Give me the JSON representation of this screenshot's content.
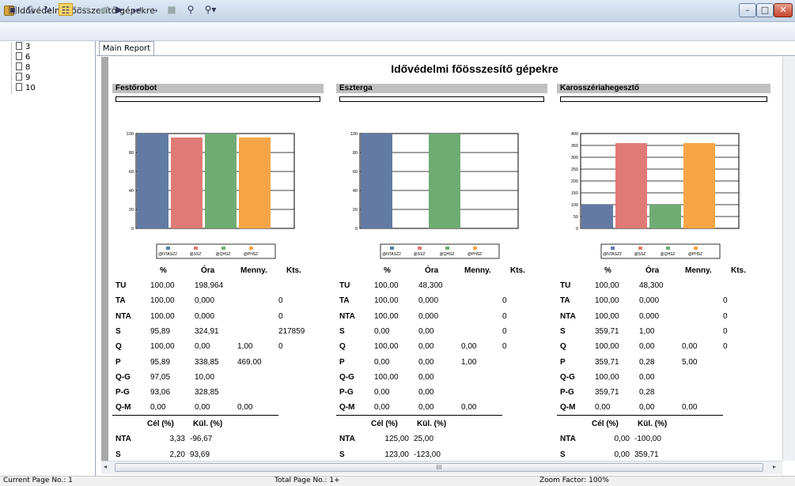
{
  "window": {
    "title": "Idővédelmi főösszesítő gépekre",
    "minimize": "–",
    "maximize": "□",
    "close": "✕"
  },
  "toolbar": {
    "icons": [
      "open-icon",
      "print-icon",
      "refresh-icon",
      "tree-toggle-icon",
      "first-page-icon",
      "prev-page-icon",
      "next-page-icon",
      "last-page-icon",
      "goto-icon",
      "stop-icon",
      "find-icon",
      "zoom-icon"
    ]
  },
  "tree": {
    "items": [
      "3",
      "6",
      "8",
      "9",
      "10"
    ]
  },
  "tabs": [
    {
      "label": "Main Report"
    }
  ],
  "report": {
    "title": "Idővédelmi főösszesítő gépekre",
    "headers": {
      "pct": "%",
      "ora": "Óra",
      "menny": "Menny.",
      "kts": "Kts.",
      "cel": "Cél (%)",
      "kul": "Kül. (%)"
    },
    "legend": [
      "@NTASZ2",
      "@SSZ",
      "@QHSZ",
      "@PHSZ"
    ],
    "colors": [
      "#627aa4",
      "#e07a76",
      "#6fac74",
      "#f6a546"
    ],
    "sections": [
      {
        "name": "Festőrobot",
        "chart_data": {
          "type": "bar",
          "categories": [
            "@NTASZ2",
            "@SSZ",
            "@QHSZ",
            "@PHSZ"
          ],
          "values": [
            100,
            95.89,
            100,
            95.89
          ],
          "ylim": [
            0,
            100
          ],
          "yticks": [
            "0",
            "20",
            "40",
            "60",
            "80",
            "100"
          ]
        },
        "rows": [
          {
            "label": "TU",
            "pct": "100,00",
            "ora": "198,964",
            "menny": "",
            "kts": ""
          },
          {
            "label": "TA",
            "pct": "100,00",
            "ora": "0,000",
            "menny": "",
            "kts": "0"
          },
          {
            "label": "NTA",
            "pct": "100,00",
            "ora": "0,000",
            "menny": "",
            "kts": "0"
          },
          {
            "label": "S",
            "pct": "95,89",
            "ora": "324,91",
            "menny": "",
            "kts": "217859"
          },
          {
            "label": "Q",
            "pct": "100,00",
            "ora": "0,00",
            "menny": "1,00",
            "kts": "0"
          },
          {
            "label": "P",
            "pct": "95,89",
            "ora": "338,85",
            "menny": "469,00",
            "kts": ""
          },
          {
            "label": "Q-G",
            "pct": "97,05",
            "ora": "10,00",
            "menny": "",
            "kts": ""
          },
          {
            "label": "P-G",
            "pct": "93,06",
            "ora": "328,85",
            "menny": "",
            "kts": ""
          },
          {
            "label": "Q-M",
            "pct": "0,00",
            "ora": "0,00",
            "menny": "0,00",
            "kts": ""
          }
        ],
        "goals": [
          {
            "label": "NTA",
            "cel": "3,33",
            "kul": "-96,67"
          },
          {
            "label": "S",
            "cel": "2,20",
            "kul": "93,69"
          }
        ]
      },
      {
        "name": "Eszterga",
        "chart_data": {
          "type": "bar",
          "categories": [
            "@NTASZ2",
            "@SSZ",
            "@QHSZ",
            "@PHSZ"
          ],
          "values": [
            100,
            0,
            100,
            0
          ],
          "ylim": [
            0,
            100
          ],
          "yticks": [
            "0",
            "20",
            "40",
            "60",
            "80",
            "100"
          ]
        },
        "rows": [
          {
            "label": "TU",
            "pct": "100,00",
            "ora": "48,300",
            "menny": "",
            "kts": ""
          },
          {
            "label": "TA",
            "pct": "100,00",
            "ora": "0,000",
            "menny": "",
            "kts": "0"
          },
          {
            "label": "NTA",
            "pct": "100,00",
            "ora": "0,000",
            "menny": "",
            "kts": "0"
          },
          {
            "label": "S",
            "pct": "0,00",
            "ora": "0,00",
            "menny": "",
            "kts": "0"
          },
          {
            "label": "Q",
            "pct": "100,00",
            "ora": "0,00",
            "menny": "0,00",
            "kts": "0"
          },
          {
            "label": "P",
            "pct": "0,00",
            "ora": "0,00",
            "menny": "1,00",
            "kts": ""
          },
          {
            "label": "Q-G",
            "pct": "100,00",
            "ora": "0,00",
            "menny": "",
            "kts": ""
          },
          {
            "label": "P-G",
            "pct": "0,00",
            "ora": "0,00",
            "menny": "",
            "kts": ""
          },
          {
            "label": "Q-M",
            "pct": "0,00",
            "ora": "0,00",
            "menny": "0,00",
            "kts": ""
          }
        ],
        "goals": [
          {
            "label": "NTA",
            "cel": "125,00",
            "kul": "25,00"
          },
          {
            "label": "S",
            "cel": "123,00",
            "kul": "-123,00"
          }
        ]
      },
      {
        "name": "Karosszériahegesztő",
        "chart_data": {
          "type": "bar",
          "categories": [
            "@NTASZ2",
            "@SSZ",
            "@QHSZ",
            "@PHSZ"
          ],
          "values": [
            100,
            359.71,
            100,
            359.71
          ],
          "ylim": [
            0,
            400
          ],
          "yticks": [
            "0",
            "50",
            "100",
            "150",
            "200",
            "250",
            "300",
            "350",
            "400"
          ]
        },
        "rows": [
          {
            "label": "TU",
            "pct": "100,00",
            "ora": "48,300",
            "menny": "",
            "kts": ""
          },
          {
            "label": "TA",
            "pct": "100,00",
            "ora": "0,000",
            "menny": "",
            "kts": "0"
          },
          {
            "label": "NTA",
            "pct": "100,00",
            "ora": "0,000",
            "menny": "",
            "kts": "0"
          },
          {
            "label": "S",
            "pct": "359,71",
            "ora": "1,00",
            "menny": "",
            "kts": "0"
          },
          {
            "label": "Q",
            "pct": "100,00",
            "ora": "0,00",
            "menny": "0,00",
            "kts": "0"
          },
          {
            "label": "P",
            "pct": "359,71",
            "ora": "0,28",
            "menny": "5,00",
            "kts": ""
          },
          {
            "label": "Q-G",
            "pct": "100,00",
            "ora": "0,00",
            "menny": "",
            "kts": ""
          },
          {
            "label": "P-G",
            "pct": "359,71",
            "ora": "0,28",
            "menny": "",
            "kts": ""
          },
          {
            "label": "Q-M",
            "pct": "0,00",
            "ora": "0,00",
            "menny": "0,00",
            "kts": ""
          }
        ],
        "goals": [
          {
            "label": "NTA",
            "cel": "0,00",
            "kul": "-100,00"
          },
          {
            "label": "S",
            "cel": "0,00",
            "kul": "359,71"
          }
        ]
      }
    ]
  },
  "scroll": {
    "hthumb": "III"
  },
  "status": {
    "current_page": "Current Page No.: 1",
    "total_page": "Total Page No.: 1+",
    "zoom": "Zoom Factor: 100%"
  }
}
